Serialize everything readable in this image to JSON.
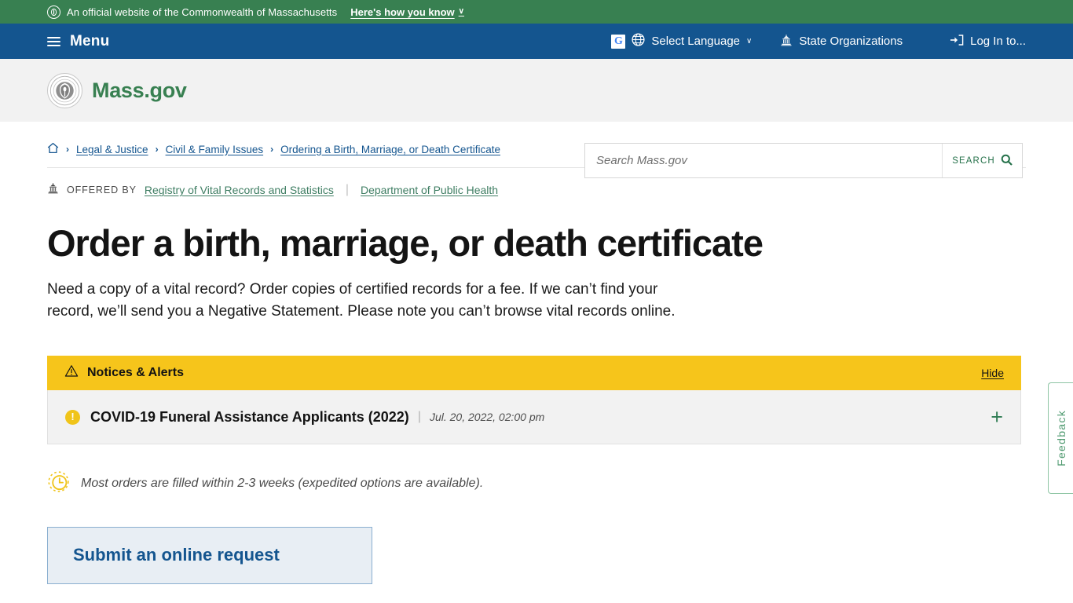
{
  "official_banner": {
    "seal_icon": "state-seal-icon",
    "text": "An official website of the Commonwealth of Massachusetts",
    "how_you_know": "Here's how you know",
    "chevron": "∨"
  },
  "nav": {
    "menu_label": "Menu",
    "menu_icon": "hamburger-icon",
    "google_logo": "G",
    "globe_icon": "globe-icon",
    "language_label": "Select Language",
    "language_chevron": "∨",
    "state_org_icon": "capitol-building-icon",
    "state_org_label": "State Organizations",
    "login_icon": "login-arrow-icon",
    "login_label": "Log In to..."
  },
  "brand": {
    "seal_icon": "massachusetts-seal-icon",
    "name": "Mass.gov"
  },
  "search": {
    "placeholder": "Search Mass.gov",
    "value": "",
    "button_label": "SEARCH",
    "button_icon": "magnifier-icon"
  },
  "breadcrumb": {
    "home_icon": "home-icon",
    "separator": "›",
    "items": [
      {
        "label": "Legal & Justice"
      },
      {
        "label": "Civil & Family Issues"
      },
      {
        "label": "Ordering a Birth, Marriage, or Death Certificate"
      }
    ]
  },
  "offered_by": {
    "icon": "capitol-building-icon",
    "label": "OFFERED BY",
    "divider": "|",
    "orgs": [
      {
        "label": "Registry of Vital Records and Statistics"
      },
      {
        "label": "Department of Public Health"
      }
    ]
  },
  "page": {
    "title": "Order a birth, marriage, or death certificate",
    "lede": "Need a copy of a vital record? Order copies of certified records for a fee. If we can’t find your record, we’ll send you a Negative Statement. Please note you can’t browse vital records online."
  },
  "alerts": {
    "header_icon": "warning-triangle-icon",
    "header_title": "Notices & Alerts",
    "hide_label": "Hide",
    "items": [
      {
        "status_icon": "alert-circle-icon",
        "title": "COVID-19 Funeral Assistance Applicants (2022)",
        "pipe": "|",
        "timestamp": "Jul. 20, 2022, 02:00 pm",
        "expand_icon": "plus-icon",
        "expand_glyph": "+"
      }
    ]
  },
  "turnaround": {
    "icon": "clock-icon",
    "text": "Most orders are filled within 2-3 weeks (expedited options are available)."
  },
  "action_box": {
    "title": "Submit an online request"
  },
  "feedback": {
    "label": "Feedback"
  },
  "colors": {
    "official_green": "#388051",
    "nav_blue": "#14558f",
    "brand_green": "#388051",
    "alert_yellow": "#f6c51b",
    "alert_dot_yellow": "#f0c419",
    "link_blue": "#14558f",
    "offered_green": "#3f7e63",
    "plus_green": "#2f7c53",
    "feedback_green": "#4f9a70",
    "action_box_bg": "#e8eef4",
    "action_box_border": "#8aafd0"
  }
}
